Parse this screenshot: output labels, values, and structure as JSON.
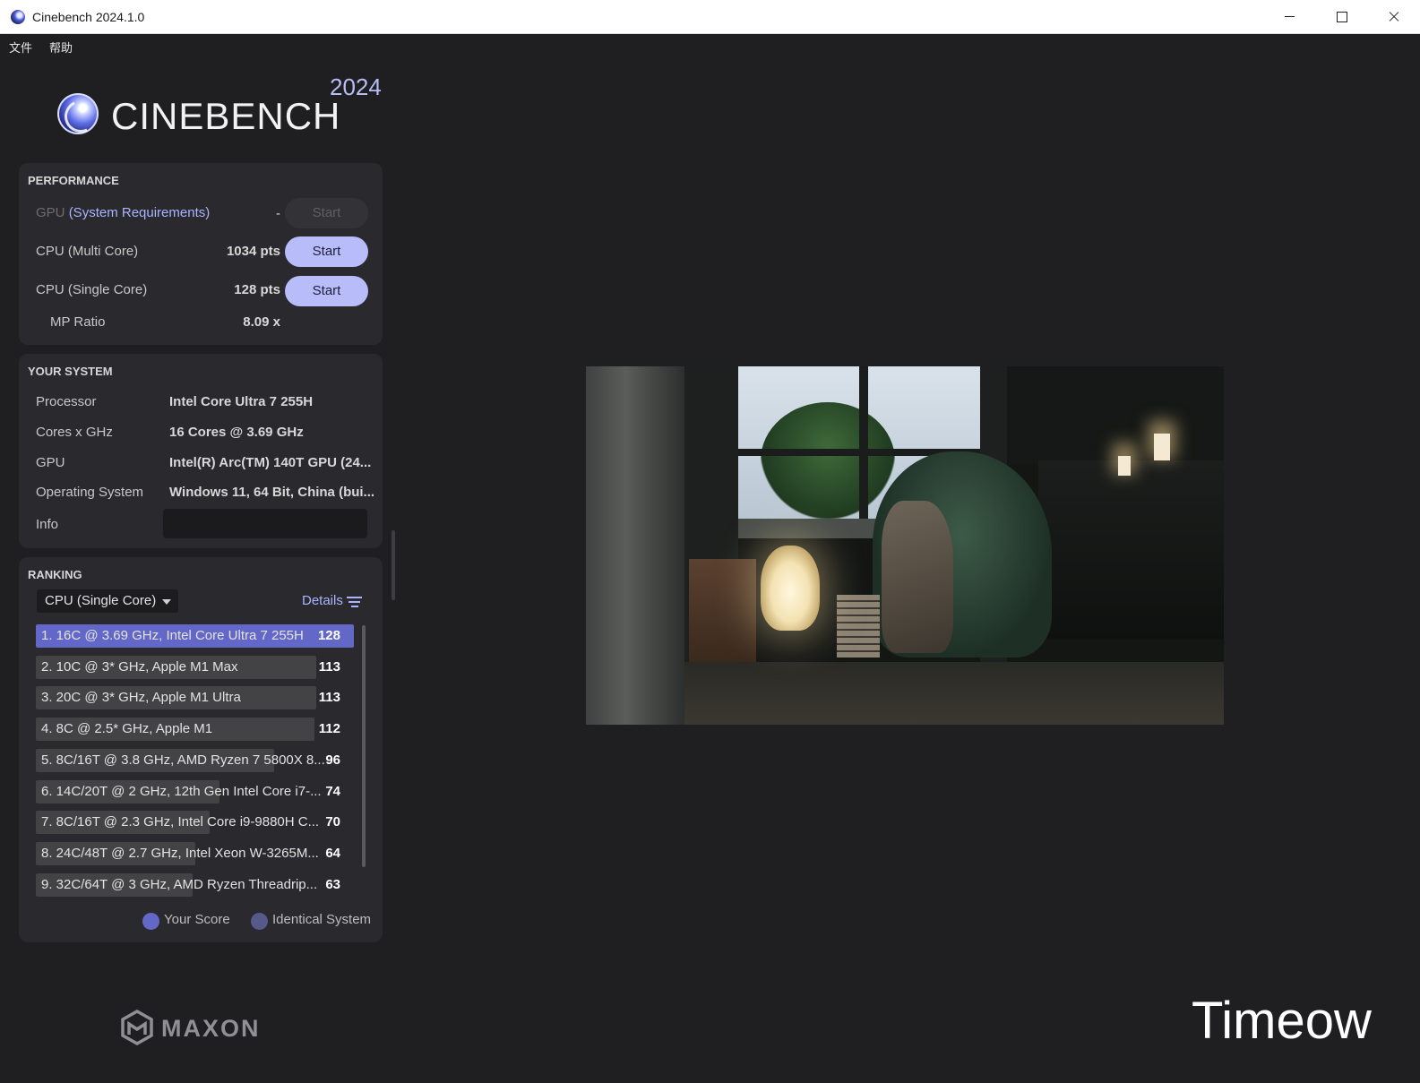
{
  "window": {
    "title": "Cinebench 2024.1.0"
  },
  "menu": {
    "file": "文件",
    "help": "帮助"
  },
  "logo": {
    "name": "CINEBENCH",
    "year": "2024"
  },
  "performance": {
    "title": "PERFORMANCE",
    "gpu_label": "GPU",
    "gpu_link": "(System Requirements)",
    "gpu_value": "-",
    "multi_label": "CPU (Multi Core)",
    "multi_value": "1034 pts",
    "single_label": "CPU (Single Core)",
    "single_value": "128 pts",
    "ratio_label": "MP Ratio",
    "ratio_value": "8.09 x",
    "start_label": "Start"
  },
  "system": {
    "title": "YOUR SYSTEM",
    "rows": [
      {
        "key": "Processor",
        "value": "Intel Core Ultra 7 255H"
      },
      {
        "key": "Cores x GHz",
        "value": "16 Cores @ 3.69 GHz"
      },
      {
        "key": "GPU",
        "value": "Intel(R) Arc(TM) 140T GPU (24..."
      },
      {
        "key": "Operating System",
        "value": "Windows 11, 64 Bit, China (bui..."
      },
      {
        "key": "Info",
        "value": ""
      }
    ]
  },
  "ranking": {
    "title": "RANKING",
    "mode": "CPU (Single Core)",
    "details": "Details",
    "max_score": 128,
    "rows": [
      {
        "label": "1. 16C @ 3.69 GHz, Intel Core Ultra 7 255H",
        "score": "128",
        "value": 128,
        "mine": true
      },
      {
        "label": "2. 10C @ 3* GHz, Apple M1 Max",
        "score": "113",
        "value": 113,
        "mine": false
      },
      {
        "label": "3. 20C @ 3* GHz, Apple M1 Ultra",
        "score": "113",
        "value": 113,
        "mine": false
      },
      {
        "label": "4. 8C @ 2.5* GHz, Apple M1",
        "score": "112",
        "value": 112,
        "mine": false
      },
      {
        "label": "5. 8C/16T @ 3.8 GHz, AMD Ryzen 7 5800X 8...",
        "score": "96",
        "value": 96,
        "mine": false
      },
      {
        "label": "6. 14C/20T @ 2 GHz, 12th Gen Intel Core i7-...",
        "score": "74",
        "value": 74,
        "mine": false
      },
      {
        "label": "7. 8C/16T @ 2.3 GHz, Intel Core i9-9880H C...",
        "score": "70",
        "value": 70,
        "mine": false
      },
      {
        "label": "8. 24C/48T @ 2.7 GHz, Intel Xeon W-3265M...",
        "score": "64",
        "value": 64,
        "mine": false
      },
      {
        "label": "9. 32C/64T @ 3 GHz, AMD Ryzen Threadrip...",
        "score": "63",
        "value": 63,
        "mine": false
      }
    ],
    "legend_your_score": "Your Score",
    "legend_identical": "Identical System"
  },
  "brand": {
    "maxon": "MAXON"
  },
  "watermark": "Timeow",
  "colors": {
    "accent": "#b8bdfa",
    "your_score": "#6368c8",
    "identical": "#555a8a",
    "link": "#aab4ff"
  }
}
